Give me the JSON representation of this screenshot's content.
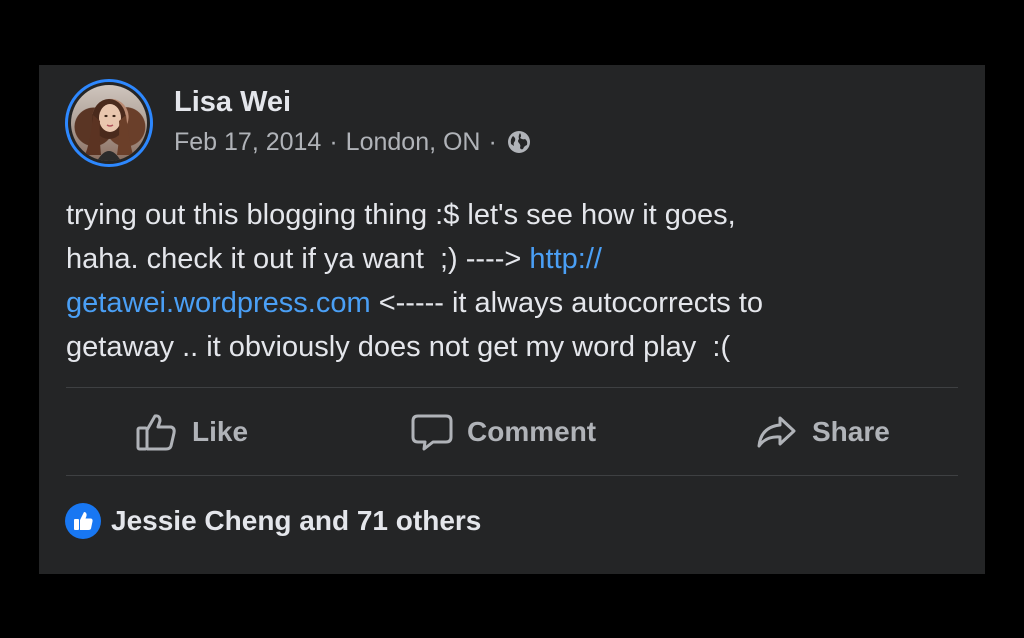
{
  "post": {
    "author": "Lisa Wei",
    "date": "Feb 17, 2014",
    "separator": "·",
    "location": "London, ON",
    "privacy_icon": "globe-icon",
    "text_before_link": "trying out this blogging thing :$ let's see how it goes,\nhaha. check it out if ya want  ;) ----> ",
    "link_text": "http://\ngetawei.wordpress.com",
    "text_after_link": " <----- it always autocorrects to\ngetaway .. it obviously does not get my word play  :("
  },
  "actions": {
    "like_label": "Like",
    "comment_label": "Comment",
    "share_label": "Share"
  },
  "reactions": {
    "icon": "like-reaction-icon",
    "summary": "Jessie Cheng and 71 others"
  },
  "colors": {
    "card_background": "#242526",
    "page_background": "#000000",
    "link": "#4a9ff5",
    "accent": "#1877f2",
    "avatar_ring": "#2d88ff"
  }
}
